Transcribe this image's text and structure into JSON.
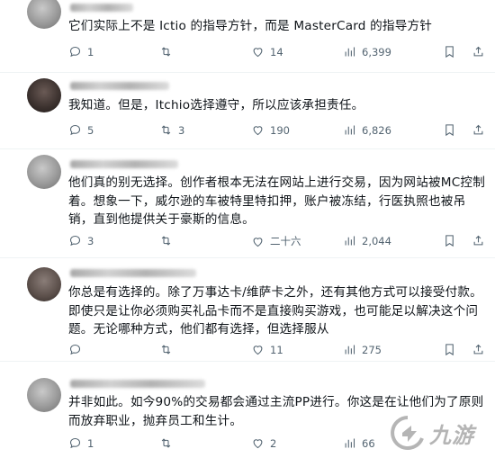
{
  "tweets": [
    {
      "text": "它们实际上不是 Ictio 的指导方针，而是 MasterCard 的指导方针",
      "replies": "1",
      "retweets": "",
      "likes": "14",
      "views": "6,399"
    },
    {
      "text": "我知道。但是，Itchio选择遵守，所以应该承担责任。",
      "replies": "5",
      "retweets": "3",
      "likes": "190",
      "views": "6,826"
    },
    {
      "text": "他们真的别无选择。创作者根本无法在网站上进行交易，因为网站被MC控制着。想象一下，威尔逊的车被特里特扣押，账户被冻结，行医执照也被吊销，直到他提供关于豪斯的信息。",
      "replies": "3",
      "retweets": "",
      "likes": "二十六",
      "views": "2,044"
    },
    {
      "text": "你总是有选择的。除了万事达卡/维萨卡之外，还有其他方式可以接受付款。即使只是让你必须购买礼品卡而不是直接购买游戏，也可能足以解决这个问题。无论哪种方式，他们都有选择，但选择服从",
      "replies": "",
      "retweets": "",
      "likes": "11",
      "views": "275"
    },
    {
      "text": "并非如此。如今90%的交易都会通过主流PP进行。你这是在让他们为了原则而放弃职业，抛弃员工和生计。",
      "replies": "1",
      "retweets": "",
      "likes": "2",
      "views": "66"
    }
  ],
  "watermark": {
    "text": "九游"
  },
  "icons": {
    "reply": "reply-icon",
    "retweet": "retweet-icon",
    "like": "heart-icon",
    "views": "views-chart-icon",
    "bookmark": "bookmark-icon",
    "share": "share-icon"
  }
}
